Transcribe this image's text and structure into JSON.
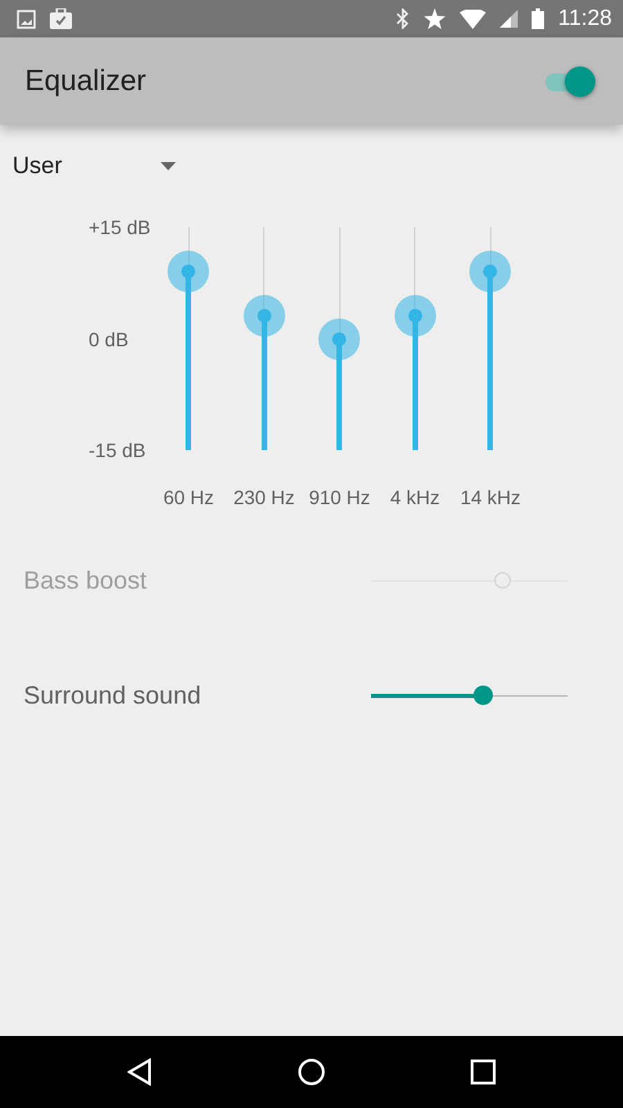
{
  "status_bar": {
    "time": "11:28"
  },
  "app_bar": {
    "title": "Equalizer",
    "switch_on": true
  },
  "preset": {
    "value": "User"
  },
  "equalizer": {
    "db_labels": [
      "+15 dB",
      "0 dB",
      "-15 dB"
    ],
    "bands": [
      {
        "label": "60 Hz",
        "level": 0.8
      },
      {
        "label": "230 Hz",
        "level": 0.6
      },
      {
        "label": "910 Hz",
        "level": 0.5
      },
      {
        "label": "4 kHz",
        "level": 0.6
      },
      {
        "label": "14 kHz",
        "level": 0.8
      }
    ]
  },
  "settings": [
    {
      "label": "Bass boost",
      "disabled": true,
      "level": 0.67
    },
    {
      "label": "Surround sound",
      "disabled": false,
      "level": 0.57
    }
  ]
}
